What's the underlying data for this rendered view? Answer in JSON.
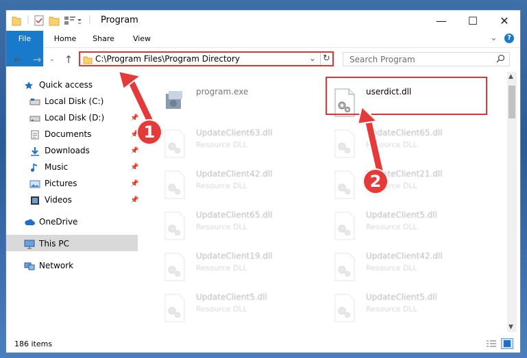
{
  "window": {
    "title": "Program",
    "controls": {
      "minimize": "—",
      "maximize": "☐",
      "close": "✕"
    }
  },
  "ribbon": {
    "tabs": [
      {
        "label": "File"
      },
      {
        "label": "Home"
      },
      {
        "label": "Share"
      },
      {
        "label": "View"
      }
    ],
    "expand_icon": "chevron-down-icon",
    "help_icon": "?"
  },
  "address": {
    "path": "C:\\Program Files\\Program Directory",
    "search_placeholder": "Search Program"
  },
  "sidebar": {
    "items": [
      {
        "label": "Quick access",
        "icon": "star-icon"
      },
      {
        "label": "Local Disk (C:)",
        "icon": "drive-icon"
      },
      {
        "label": "Local Disk (D:)",
        "icon": "drive-icon"
      },
      {
        "label": "Documents",
        "icon": "documents-icon"
      },
      {
        "label": "Downloads",
        "icon": "download-icon"
      },
      {
        "label": "Music",
        "icon": "music-icon"
      },
      {
        "label": "Pictures",
        "icon": "pictures-icon"
      },
      {
        "label": "Videos",
        "icon": "videos-icon"
      },
      {
        "label": "OneDrive",
        "icon": "cloud-icon"
      },
      {
        "label": "This PC",
        "icon": "computer-icon"
      },
      {
        "label": "Network",
        "icon": "network-icon"
      }
    ]
  },
  "files": {
    "highlighted": {
      "name": "userdict.dll"
    },
    "program": {
      "name": "program.exe"
    },
    "blurred": [
      {
        "name": "UpdateClient63.dll",
        "desc": "Resource DLL"
      },
      {
        "name": "UpdateClient65.dll",
        "desc": "Resource DLL"
      },
      {
        "name": "UpdateClient42.dll",
        "desc": "Resource DLL"
      },
      {
        "name": "UpdateClient21.dll",
        "desc": "Resource DLL"
      },
      {
        "name": "UpdateClient65.dll",
        "desc": "Resource DLL"
      },
      {
        "name": "UpdateClient5.dll",
        "desc": "Resource DLL"
      },
      {
        "name": "UpdateClient19.dll",
        "desc": "Resource DLL"
      },
      {
        "name": "UpdateClient42.dll",
        "desc": "Resource DLL"
      },
      {
        "name": "UpdateClient5.dll",
        "desc": "Resource DLL"
      },
      {
        "name": "UpdateClient5.dll",
        "desc": "Resource DLL"
      }
    ]
  },
  "status": {
    "count": "186 items"
  },
  "annotations": {
    "step1": "1",
    "step2": "2"
  },
  "colors": {
    "accent": "#1979ca",
    "annotation_red": "#e53a3a"
  }
}
